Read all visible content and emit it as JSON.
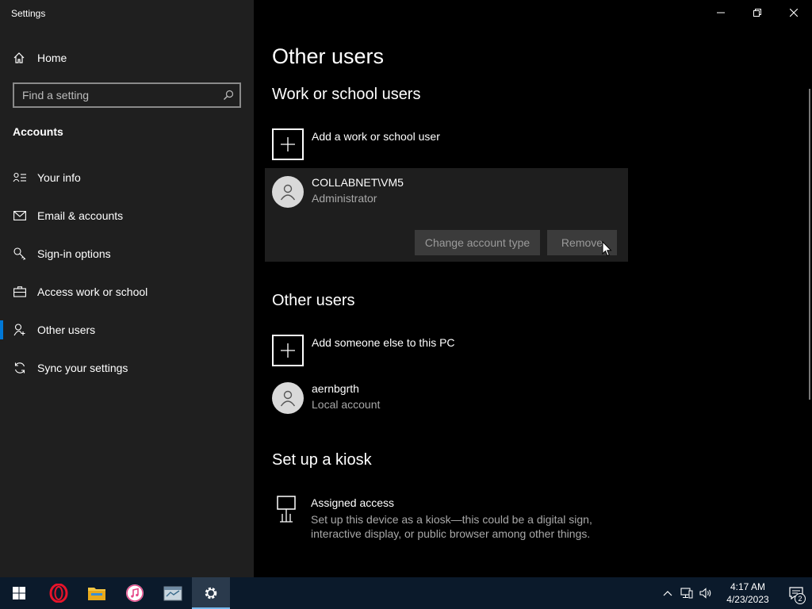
{
  "window": {
    "title": "Settings"
  },
  "sidebar": {
    "home_label": "Home",
    "search_placeholder": "Find a setting",
    "section_label": "Accounts",
    "items": [
      {
        "label": "Your info",
        "icon": "contact-card-icon"
      },
      {
        "label": "Email & accounts",
        "icon": "mail-icon"
      },
      {
        "label": "Sign-in options",
        "icon": "key-icon"
      },
      {
        "label": "Access work or school",
        "icon": "briefcase-icon"
      },
      {
        "label": "Other users",
        "icon": "add-person-icon",
        "active": true
      },
      {
        "label": "Sync your settings",
        "icon": "sync-icon"
      }
    ]
  },
  "main": {
    "title": "Other users",
    "work_school": {
      "heading": "Work or school users",
      "add_label": "Add a work or school user",
      "user": {
        "name": "COLLABNET\\VM5",
        "role": "Administrator"
      },
      "change_button": "Change account type",
      "remove_button": "Remove"
    },
    "other_users": {
      "heading": "Other users",
      "add_label": "Add someone else to this PC",
      "user": {
        "name": "aernbgrth",
        "role": "Local account"
      }
    },
    "kiosk": {
      "heading": "Set up a kiosk",
      "title": "Assigned access",
      "description": "Set up this device as a kiosk—this could be a digital sign, interactive display, or public browser among other things."
    }
  },
  "taskbar": {
    "time": "4:17 AM",
    "date": "4/23/2023",
    "notification_count": "2",
    "accent": "#0078d7"
  }
}
